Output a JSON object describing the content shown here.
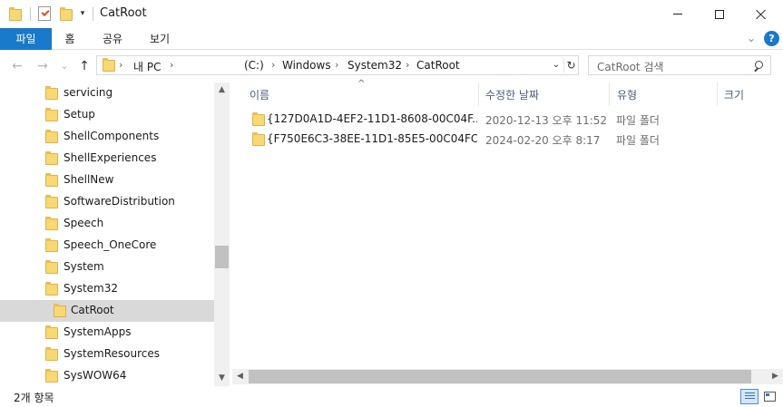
{
  "window": {
    "title": "CatRoot",
    "qa_dropdown_glyph": "▾"
  },
  "ribbon": {
    "tabs": [
      {
        "label": "파일"
      },
      {
        "label": "홈"
      },
      {
        "label": "공유"
      },
      {
        "label": "보기"
      }
    ],
    "chevron_glyph": "⌄",
    "help_glyph": "?"
  },
  "nav": {
    "back_glyph": "←",
    "forward_glyph": "→",
    "recent_glyph": "⌄",
    "up_glyph": "↑"
  },
  "address": {
    "crumbs": [
      "내 PC",
      "(C:)",
      "Windows",
      "System32",
      "CatRoot"
    ],
    "sep_glyph": "›",
    "dropdown_glyph": "⌄",
    "refresh_glyph": "↻"
  },
  "search": {
    "placeholder": "CatRoot 검색"
  },
  "tree": {
    "items": [
      {
        "label": "servicing"
      },
      {
        "label": "Setup"
      },
      {
        "label": "ShellComponents"
      },
      {
        "label": "ShellExperiences"
      },
      {
        "label": "ShellNew"
      },
      {
        "label": "SoftwareDistribution"
      },
      {
        "label": "Speech"
      },
      {
        "label": "Speech_OneCore"
      },
      {
        "label": "System"
      },
      {
        "label": "System32"
      },
      {
        "label": "CatRoot",
        "selected": true
      },
      {
        "label": "SystemApps"
      },
      {
        "label": "SystemResources"
      },
      {
        "label": "SysWOW64"
      }
    ],
    "scroll_up_glyph": "▲",
    "scroll_down_glyph": "▼"
  },
  "content": {
    "sort_glyph": "^",
    "columns": [
      {
        "label": "이름"
      },
      {
        "label": "수정한 날짜"
      },
      {
        "label": "유형"
      },
      {
        "label": "크기"
      }
    ],
    "rows": [
      {
        "name": "{127D0A1D-4EF2-11D1-8608-00C04F...",
        "date": "2020-12-13 오후 11:52",
        "type": "파일 폴더"
      },
      {
        "name": "{F750E6C3-38EE-11D1-85E5-00C04FC...",
        "date": "2024-02-20 오후 8:17",
        "type": "파일 폴더"
      }
    ],
    "scroll_left_glyph": "◀",
    "scroll_right_glyph": "▶"
  },
  "status": {
    "item_count": "2개 항목"
  },
  "colors": {
    "accent": "#1979ca",
    "folder": "#f8d775",
    "selection": "#d9d9d9"
  }
}
